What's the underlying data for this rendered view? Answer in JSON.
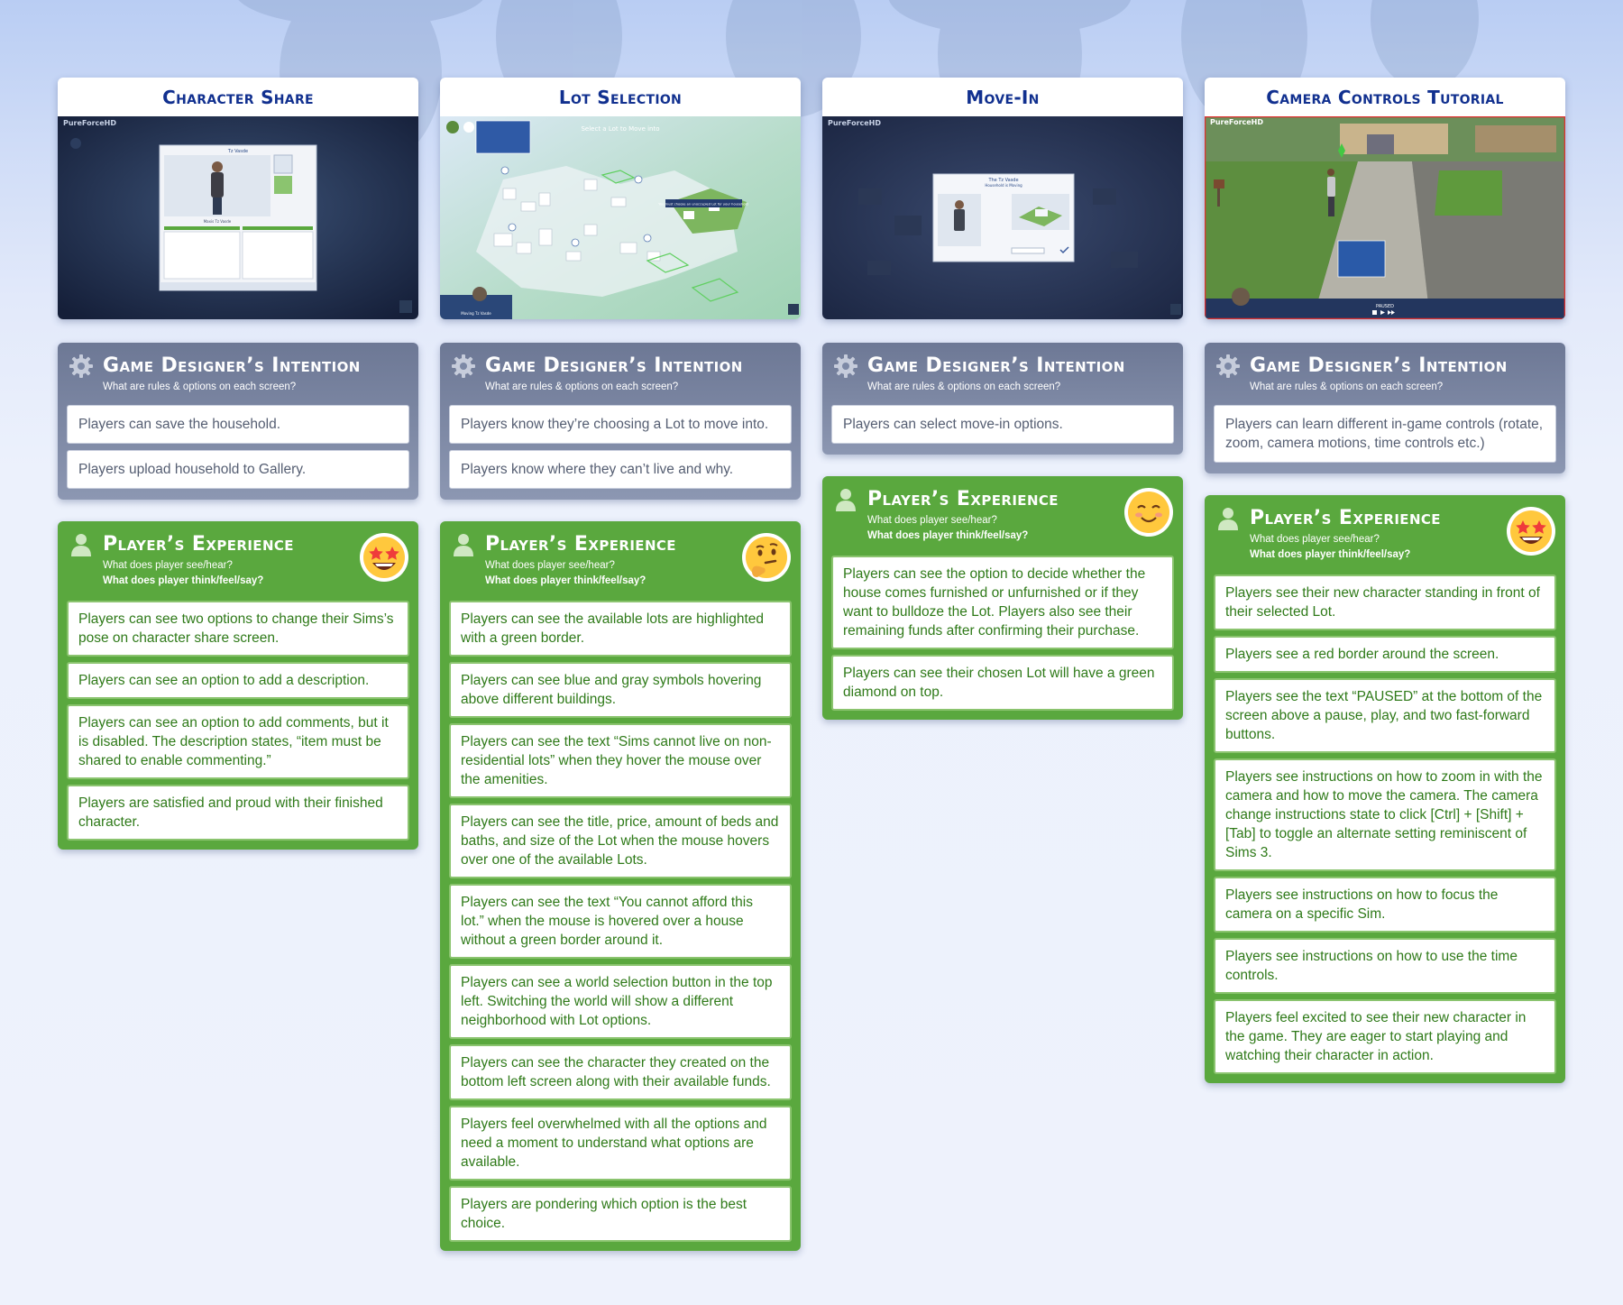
{
  "intent_header": {
    "title": "Game Designer’s Intention",
    "subtitle": "What are rules & options on each screen?"
  },
  "experience_header": {
    "title": "Player’s Experience",
    "subtitle_see": "What does player see/hear?",
    "subtitle_think": "What does player think/feel/say?"
  },
  "colors": {
    "title_blue": "#11308f",
    "intent_card": "#7a86a3",
    "experience_card": "#5aa83e",
    "experience_text": "#2f7a19"
  },
  "columns": [
    {
      "title": "Character Share",
      "screenshot": {
        "watermark": "PureForceHD",
        "header": "Tz Vasde",
        "caption": "Maxis Tz Vasde"
      },
      "emoji": "star-struck-emoji",
      "intentions": [
        "Players can save the household.",
        "Players upload household to Gallery."
      ],
      "experiences": [
        "Players can see two options to change their Sims’s pose on character share screen.",
        "Players can see an option to add a description.",
        "Players can see an option to add comments, but it is disabled. The description states, “item must be shared to enable commenting.”",
        "Players are satisfied and proud with their finished character."
      ]
    },
    {
      "title": "Lot Selection",
      "screenshot": {
        "heading": "Select a Lot to Move into",
        "tooltip": "You must choose an unoccupied Lot for your household",
        "funds_label": "Moving Tz Vasde"
      },
      "emoji": "thinking-face-emoji",
      "intentions": [
        "Players know they’re choosing a Lot to move into.",
        "Players know where they can’t live and why."
      ],
      "experiences": [
        "Players can see the available lots are highlighted with a green border.",
        "Players can see blue and gray symbols hovering above different buildings.",
        "Players can see the text “Sims cannot live on non-residential lots” when they hover the mouse over the amenities.",
        "Players can see the title, price, amount of beds and baths, and size of the Lot when the mouse hovers over one of the available Lots.",
        "Players can see the text “You cannot afford this lot.” when the mouse is hovered over a house without a green border around it.",
        "Players can see a world selection button in the top left. Switching the world will show a different neighborhood with Lot options.",
        "Players can see the character they created on the bottom left screen along with their available funds.",
        "Players feel overwhelmed with all the options and need a moment to understand what options are available.",
        "Players are pondering which option is the best choice."
      ]
    },
    {
      "title": "Move-In",
      "screenshot": {
        "watermark": "PureForceHD",
        "dialog_title": "The Tz Vasde",
        "dialog_sub": "Household is Moving"
      },
      "emoji": "smiling-face-emoji",
      "intentions": [
        "Players can select move-in options."
      ],
      "experiences": [
        "Players can see the option to decide whether the house comes furnished or unfurnished or if they want to bulldoze the Lot. Players also see their remaining funds after confirming their purchase.",
        "Players can see their chosen Lot will have a green diamond on top."
      ]
    },
    {
      "title": "Camera Controls Tutorial",
      "screenshot": {
        "watermark": "PureForceHD",
        "status": "PAUSED"
      },
      "emoji": "star-struck-emoji",
      "intentions": [
        "Players can learn different in-game controls (rotate, zoom, camera motions, time controls etc.)"
      ],
      "experiences": [
        "Players see their new character standing in front of their selected Lot.",
        "Players see a red border around the screen.",
        "Players see the text “PAUSED” at the bottom of the screen above a pause, play, and two fast-forward buttons.",
        "Players see instructions on how to zoom in with the camera and how to move the camera. The camera change instructions state to click [Ctrl] + [Shift] + [Tab] to toggle an alternate setting reminiscent of Sims 3.",
        "Players see instructions on how to focus the camera on a specific Sim.",
        "Players see instructions on how to use the time controls.",
        "Players feel excited to see their new character in the game. They are eager to start playing and watching their character in action."
      ]
    }
  ]
}
